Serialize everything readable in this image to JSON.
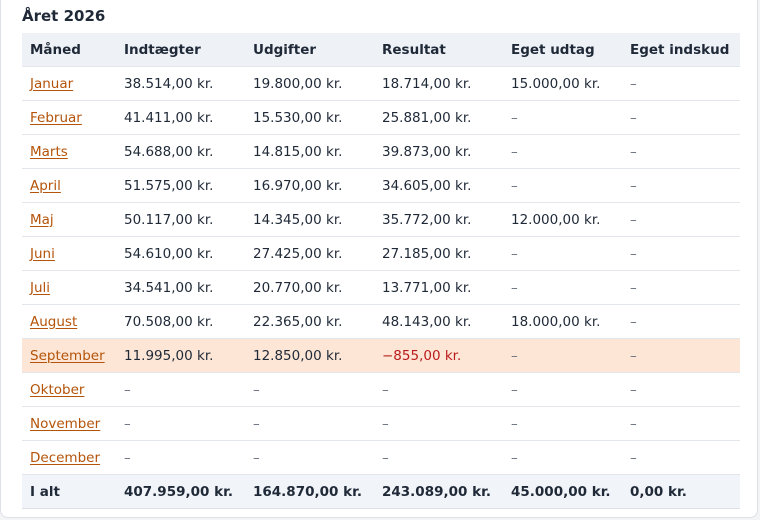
{
  "page": {
    "title": "Året 2026"
  },
  "table": {
    "headers": {
      "month": "Måned",
      "income": "Indtægter",
      "expenses": "Udgifter",
      "result": "Resultat",
      "withdrawal": "Eget udtag",
      "deposit": "Eget indskud"
    },
    "rows": [
      {
        "month": "Januar",
        "income": "38.514,00 kr.",
        "expenses": "19.800,00 kr.",
        "result": "18.714,00 kr.",
        "withdrawal": "15.000,00 kr.",
        "deposit": "–"
      },
      {
        "month": "Februar",
        "income": "41.411,00 kr.",
        "expenses": "15.530,00 kr.",
        "result": "25.881,00 kr.",
        "withdrawal": "–",
        "deposit": "–"
      },
      {
        "month": "Marts",
        "income": "54.688,00 kr.",
        "expenses": "14.815,00 kr.",
        "result": "39.873,00 kr.",
        "withdrawal": "–",
        "deposit": "–"
      },
      {
        "month": "April",
        "income": "51.575,00 kr.",
        "expenses": "16.970,00 kr.",
        "result": "34.605,00 kr.",
        "withdrawal": "–",
        "deposit": "–"
      },
      {
        "month": "Maj",
        "income": "50.117,00 kr.",
        "expenses": "14.345,00 kr.",
        "result": "35.772,00 kr.",
        "withdrawal": "12.000,00 kr.",
        "deposit": "–"
      },
      {
        "month": "Juni",
        "income": "54.610,00 kr.",
        "expenses": "27.425,00 kr.",
        "result": "27.185,00 kr.",
        "withdrawal": "–",
        "deposit": "–"
      },
      {
        "month": "Juli",
        "income": "34.541,00 kr.",
        "expenses": "20.770,00 kr.",
        "result": "13.771,00 kr.",
        "withdrawal": "–",
        "deposit": "–"
      },
      {
        "month": "August",
        "income": "70.508,00 kr.",
        "expenses": "22.365,00 kr.",
        "result": "48.143,00 kr.",
        "withdrawal": "18.000,00 kr.",
        "deposit": "–"
      },
      {
        "month": "September",
        "income": "11.995,00 kr.",
        "expenses": "12.850,00 kr.",
        "result": "−855,00 kr.",
        "withdrawal": "–",
        "deposit": "–"
      },
      {
        "month": "Oktober",
        "income": "–",
        "expenses": "–",
        "result": "–",
        "withdrawal": "–",
        "deposit": "–"
      },
      {
        "month": "November",
        "income": "–",
        "expenses": "–",
        "result": "–",
        "withdrawal": "–",
        "deposit": "–"
      },
      {
        "month": "December",
        "income": "–",
        "expenses": "–",
        "result": "–",
        "withdrawal": "–",
        "deposit": "–"
      }
    ],
    "totals": {
      "label": "I alt",
      "income": "407.959,00 kr.",
      "expenses": "164.870,00 kr.",
      "result": "243.089,00 kr.",
      "withdrawal": "45.000,00 kr.",
      "deposit": "0,00 kr."
    }
  },
  "colors": {
    "link": "#b45309",
    "highlight_row": "#fde6d6",
    "negative": "#b91c1c",
    "header_bg": "#eef2f7"
  }
}
